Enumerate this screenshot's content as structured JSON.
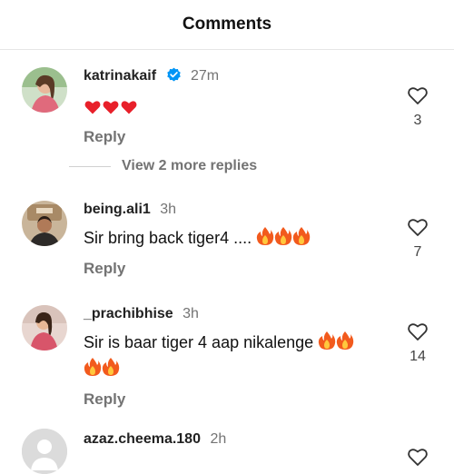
{
  "header": {
    "title": "Comments"
  },
  "comments": [
    {
      "username": "katrinakaif",
      "verified": true,
      "time": "27m",
      "text": "",
      "emojis": "hearts",
      "reply_label": "Reply",
      "likes": "3"
    },
    {
      "username": "being.ali1",
      "time": "3h",
      "text": "Sir bring back tiger4 .... ",
      "reply_label": "Reply",
      "likes": "7"
    },
    {
      "username": "_prachibhise",
      "time": "3h",
      "text": "Sir is baar tiger 4 aap nikalenge ",
      "reply_label": "Reply",
      "likes": "14"
    },
    {
      "username": "azaz.cheema.180",
      "time": "2h"
    }
  ],
  "view_more": {
    "label": "View 2 more replies"
  },
  "colors": {
    "verified": "#0095f6",
    "muted": "#737373",
    "heart": "#e8202a",
    "fire": "#f25a1d"
  }
}
